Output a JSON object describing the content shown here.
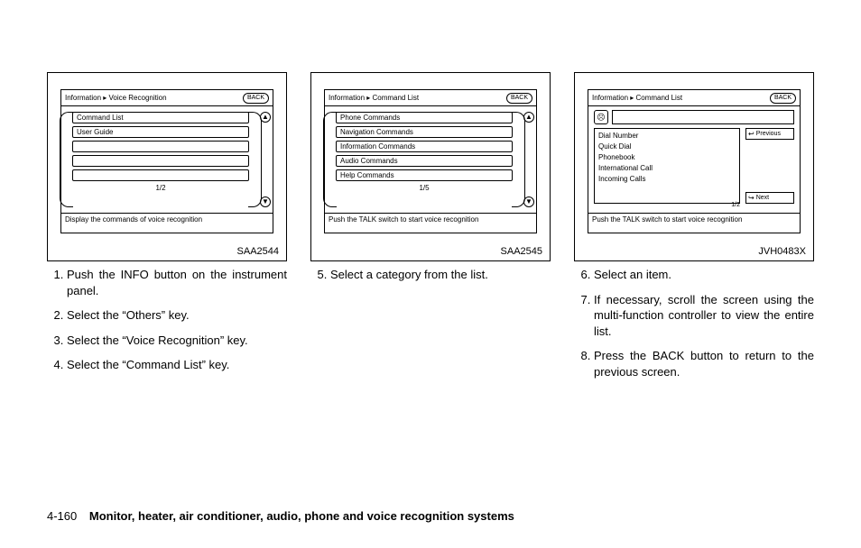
{
  "figures": {
    "a": {
      "caption": "SAA2544",
      "breadcrumb": "Information ▸ Voice Recognition",
      "back": "BACK",
      "rows": [
        "Command List",
        "User Guide",
        "",
        "",
        ""
      ],
      "pager": "1/2",
      "status": "Display the commands of voice recognition"
    },
    "b": {
      "caption": "SAA2545",
      "breadcrumb": "Information ▸ Command List",
      "back": "BACK",
      "rows": [
        "Phone Commands",
        "Navigation Commands",
        "Information Commands",
        "Audio Commands",
        "Help Commands"
      ],
      "pager": "1/5",
      "status": "Push the TALK switch to start voice recognition"
    },
    "c": {
      "caption": "JVH0483X",
      "breadcrumb": "Information ▸ Command List",
      "back": "BACK",
      "items": [
        "Dial Number",
        "Quick Dial",
        "Phonebook",
        "International Call",
        "Incoming Calls"
      ],
      "prev": "Previous",
      "next": "Next",
      "pager": "1/2",
      "status": "Push the TALK switch to start voice recognition"
    }
  },
  "steps_col1": {
    "s1": "Push the INFO button on the instrument panel.",
    "s2": "Select the “Others” key.",
    "s3": "Select the “Voice Recognition” key.",
    "s4": "Select the “Command List” key."
  },
  "steps_col2": {
    "s5": "Select a category from the list."
  },
  "steps_col3": {
    "s6": "Select an item.",
    "s7": "If necessary, scroll the screen using the multi-function controller to view the entire list.",
    "s8": "Press the BACK button to return to the previous screen."
  },
  "footer": {
    "page": "4-160",
    "title": "Monitor, heater, air conditioner, audio, phone and voice recognition systems"
  }
}
